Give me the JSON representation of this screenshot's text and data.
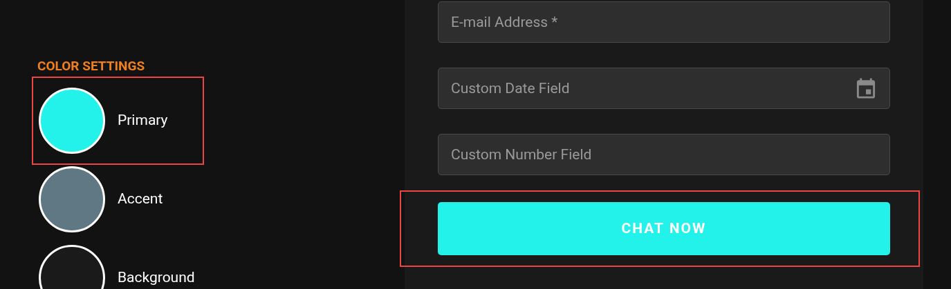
{
  "color_settings": {
    "heading": "COLOR SETTINGS",
    "items": [
      {
        "label": "Primary",
        "color": "#22f2ea",
        "highlighted": true
      },
      {
        "label": "Accent",
        "color": "#607884",
        "highlighted": false
      },
      {
        "label": "Background",
        "color": "#1a1a1a",
        "highlighted": false
      }
    ]
  },
  "form": {
    "fields": [
      {
        "placeholder": "E-mail Address *",
        "kind": "text"
      },
      {
        "placeholder": "Custom Date Field",
        "kind": "date"
      },
      {
        "placeholder": "Custom Number Field",
        "kind": "number"
      }
    ],
    "submit": {
      "label": "CHAT NOW",
      "highlighted": true
    }
  }
}
